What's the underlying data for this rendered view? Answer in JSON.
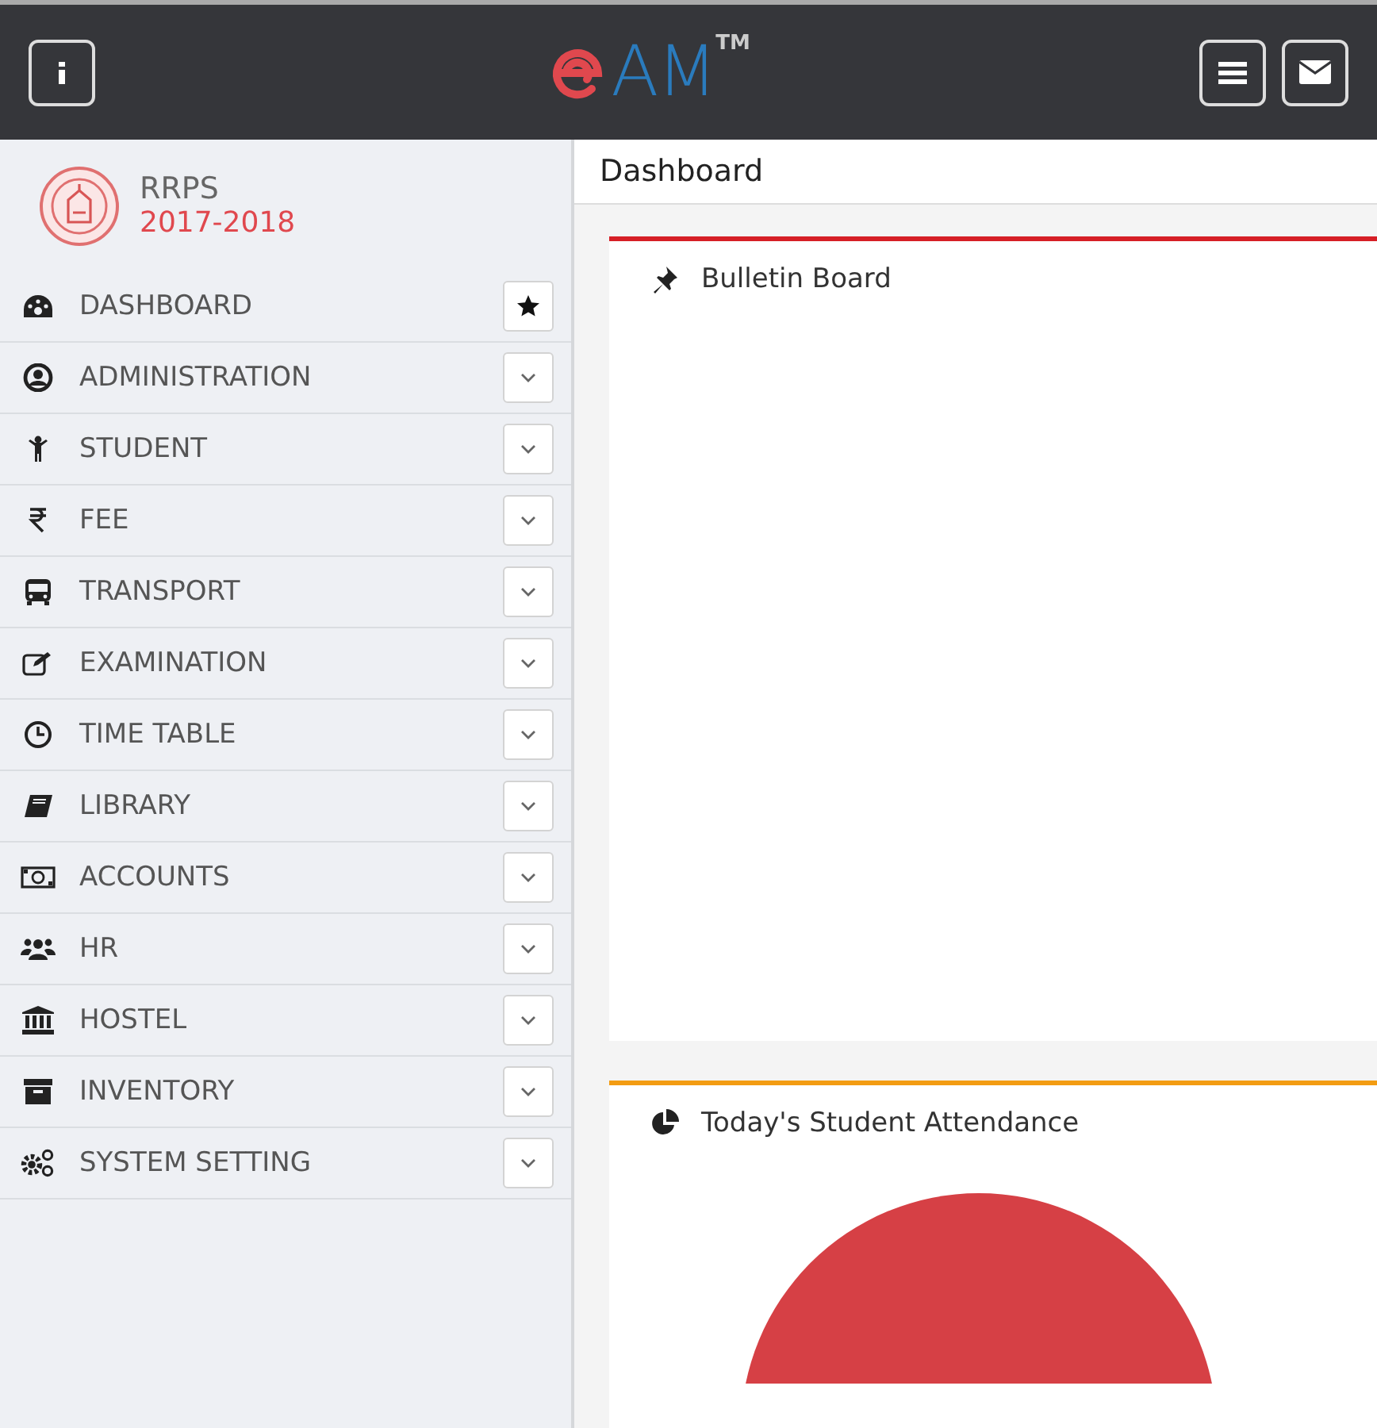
{
  "header": {
    "logo": {
      "letters": "AM",
      "trademark": "TM"
    }
  },
  "sidebar": {
    "school": {
      "name": "RRPS",
      "session": "2017-2018"
    },
    "items": [
      {
        "label": "DASHBOARD",
        "kind": "star"
      },
      {
        "label": "ADMINISTRATION",
        "kind": "expand"
      },
      {
        "label": "STUDENT",
        "kind": "expand"
      },
      {
        "label": "FEE",
        "kind": "expand"
      },
      {
        "label": "TRANSPORT",
        "kind": "expand"
      },
      {
        "label": "EXAMINATION",
        "kind": "expand"
      },
      {
        "label": "TIME TABLE",
        "kind": "expand"
      },
      {
        "label": "LIBRARY",
        "kind": "expand"
      },
      {
        "label": "ACCOUNTS",
        "kind": "expand"
      },
      {
        "label": "HR",
        "kind": "expand"
      },
      {
        "label": "HOSTEL",
        "kind": "expand"
      },
      {
        "label": "INVENTORY",
        "kind": "expand"
      },
      {
        "label": "SYSTEM SETTING",
        "kind": "expand"
      }
    ]
  },
  "page_title": "Dashboard",
  "panels": [
    {
      "title": "Bulletin Board",
      "color": "#d61f26",
      "kind": "bulletin"
    },
    {
      "title": "Today's Student Attendance",
      "color": "#f39c12",
      "kind": "pie"
    }
  ]
}
